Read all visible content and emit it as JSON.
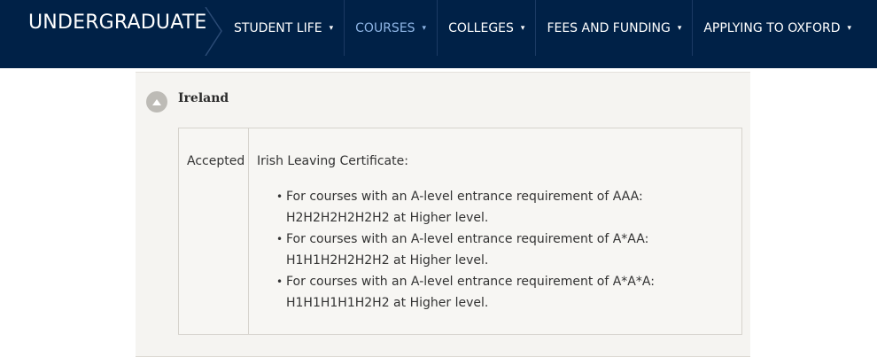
{
  "header": {
    "brand": "UNDERGRADUATE",
    "nav": [
      {
        "label": "STUDENT LIFE",
        "active": false
      },
      {
        "label": "COURSES",
        "active": true
      },
      {
        "label": "COLLEGES",
        "active": false
      },
      {
        "label": "FEES AND FUNDING",
        "active": false
      },
      {
        "label": "APPLYING TO OXFORD",
        "active": false
      }
    ],
    "caret": "▾"
  },
  "section": {
    "title": "Ireland",
    "expanded": true,
    "row": {
      "status": "Accepted",
      "qualification": "Irish Leaving Certificate:",
      "requirements": [
        {
          "line1": "For courses with an A-level entrance requirement of AAA:",
          "line2": "H2H2H2H2H2H2 at Higher level."
        },
        {
          "line1": "For courses with an A-level entrance requirement of A*AA:",
          "line2": "H1H1H2H2H2H2 at Higher level."
        },
        {
          "line1": "For courses with an A-level entrance requirement of A*A*A:",
          "line2": "H1H1H1H1H2H2 at Higher level."
        }
      ]
    }
  },
  "colors": {
    "nav_background": "#002147",
    "nav_active": "#8fb6e6",
    "panel_background": "#f5f4f1"
  }
}
